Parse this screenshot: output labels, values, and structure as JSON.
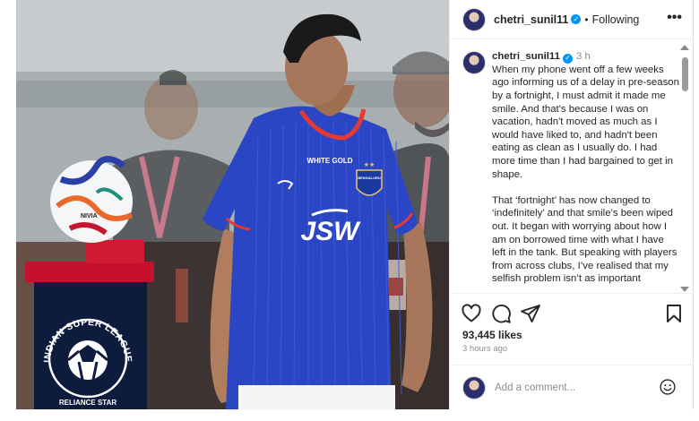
{
  "post": {
    "username": "chetri_sunil11",
    "follow_status": "Following",
    "header_separator": "•",
    "more_glyph": "•••",
    "verified_glyph": "✓",
    "caption": {
      "time_ago": "3 h",
      "paragraphs": [
        "When my phone went off a few weeks ago informing us of a delay in pre-season by a fortnight, I must admit it made me smile. And that's because I was on vacation, hadn't moved as much as I would have liked to, and hadn't been eating as clean as I usually do. I had more time than I had bargained to get in shape.",
        "That ‘fortnight’ has now changed to ‘indefinitely’ and that smile’s been wiped out. It began with worrying about how I am on borrowed time with what I have left in the tank. But speaking with players from across clubs, I’ve realised that my selfish problem isn’t as important"
      ]
    },
    "likes": "93,445 likes",
    "posted": "3 hours ago",
    "comment_placeholder": "Add a comment...",
    "actions": [
      "heart-icon",
      "comment-icon",
      "share-icon",
      "bookmark-icon",
      "emoji-icon"
    ]
  },
  "photo": {
    "kit_sponsor": "JSW",
    "shirt_sponsor": "WHITE GOLD",
    "club_badge_text": "BENGALURU",
    "ball_brand": "NIVIA",
    "podium_text": "INDIAN SUPER LEAGUE",
    "podium_subtext": "RELIANCE STAR",
    "colors": {
      "kit_blue": "#2a46c4",
      "kit_trim": "#e53935",
      "podium_red": "#c8102e",
      "podium_navy": "#0d1b3d",
      "verified_blue": "#0095f6"
    }
  }
}
